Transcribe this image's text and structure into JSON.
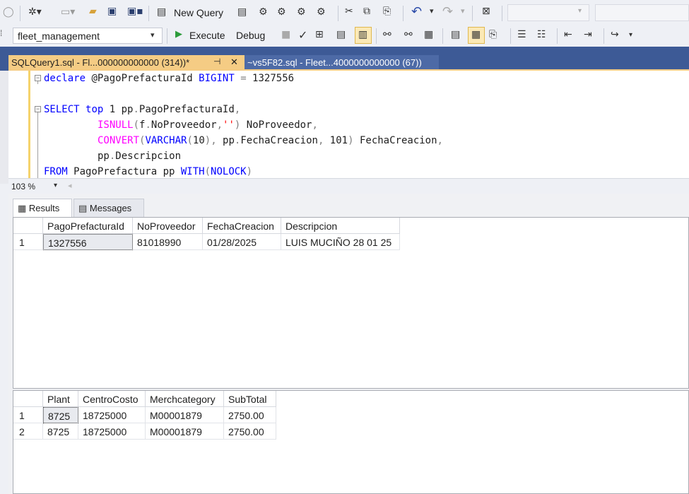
{
  "toolbar": {
    "new_query_label": "New Query",
    "database": "fleet_management",
    "execute_label": "Execute",
    "debug_label": "Debug",
    "icons": [
      "new-project-icon",
      "add-item-icon",
      "open-folder-icon",
      "save-icon",
      "save-all-icon",
      "new-query-icon",
      "mdx-query-icon",
      "dmx-query-icon",
      "xmla-query-icon",
      "dax-query-icon",
      "cut-icon",
      "copy-icon",
      "paste-icon",
      "undo-icon",
      "redo-icon",
      "activity-monitor-icon",
      "check-syntax-icon",
      "display-plan-icon",
      "query-options-icon",
      "intellisense-icon",
      "results-to-text-icon",
      "results-to-grid-icon",
      "results-to-file-icon",
      "comment-icon",
      "uncomment-icon",
      "outdent-icon",
      "indent-icon",
      "specify-values-icon"
    ]
  },
  "tabs": [
    {
      "label": "SQLQuery1.sql - Fl...000000000000 (314))*",
      "pin": "⊣",
      "close": "✕",
      "active": true
    },
    {
      "label": "~vs5F82.sql - Fleet...4000000000000 (67))",
      "active": false
    }
  ],
  "editor": {
    "lines": [
      [
        "declare @PagoPrefacturaId BIGINT = 1327556"
      ],
      [
        ""
      ],
      [
        "SELECT top 1 pp.PagoPrefacturaId,"
      ],
      [
        "ISNULL(f.NoProveedor,'') NoProveedor,"
      ],
      [
        "CONVERT(VARCHAR(10), pp.FechaCreacion, 101) FechaCreacion,"
      ],
      [
        "pp.Descripcion"
      ],
      [
        "FROM PagoPrefactura pp WITH(NOLOCK)"
      ]
    ]
  },
  "zoom": "103 %",
  "results_tabs": {
    "results": "Results",
    "messages": "Messages"
  },
  "grid1": {
    "columns": [
      "PagoPrefacturaId",
      "NoProveedor",
      "FechaCreacion",
      "Descripcion"
    ],
    "rows": [
      {
        "num": "1",
        "cells": [
          "1327556",
          "81018990",
          "01/28/2025",
          "LUIS MUCIÑO 28 01 25"
        ]
      }
    ]
  },
  "grid2": {
    "columns": [
      "Plant",
      "CentroCosto",
      "Merchcategory",
      "SubTotal"
    ],
    "rows": [
      {
        "num": "1",
        "cells": [
          "8725",
          "18725000",
          "M00001879",
          "2750.00"
        ]
      },
      {
        "num": "2",
        "cells": [
          "8725",
          "18725000",
          "M00001879",
          "2750.00"
        ]
      }
    ]
  }
}
